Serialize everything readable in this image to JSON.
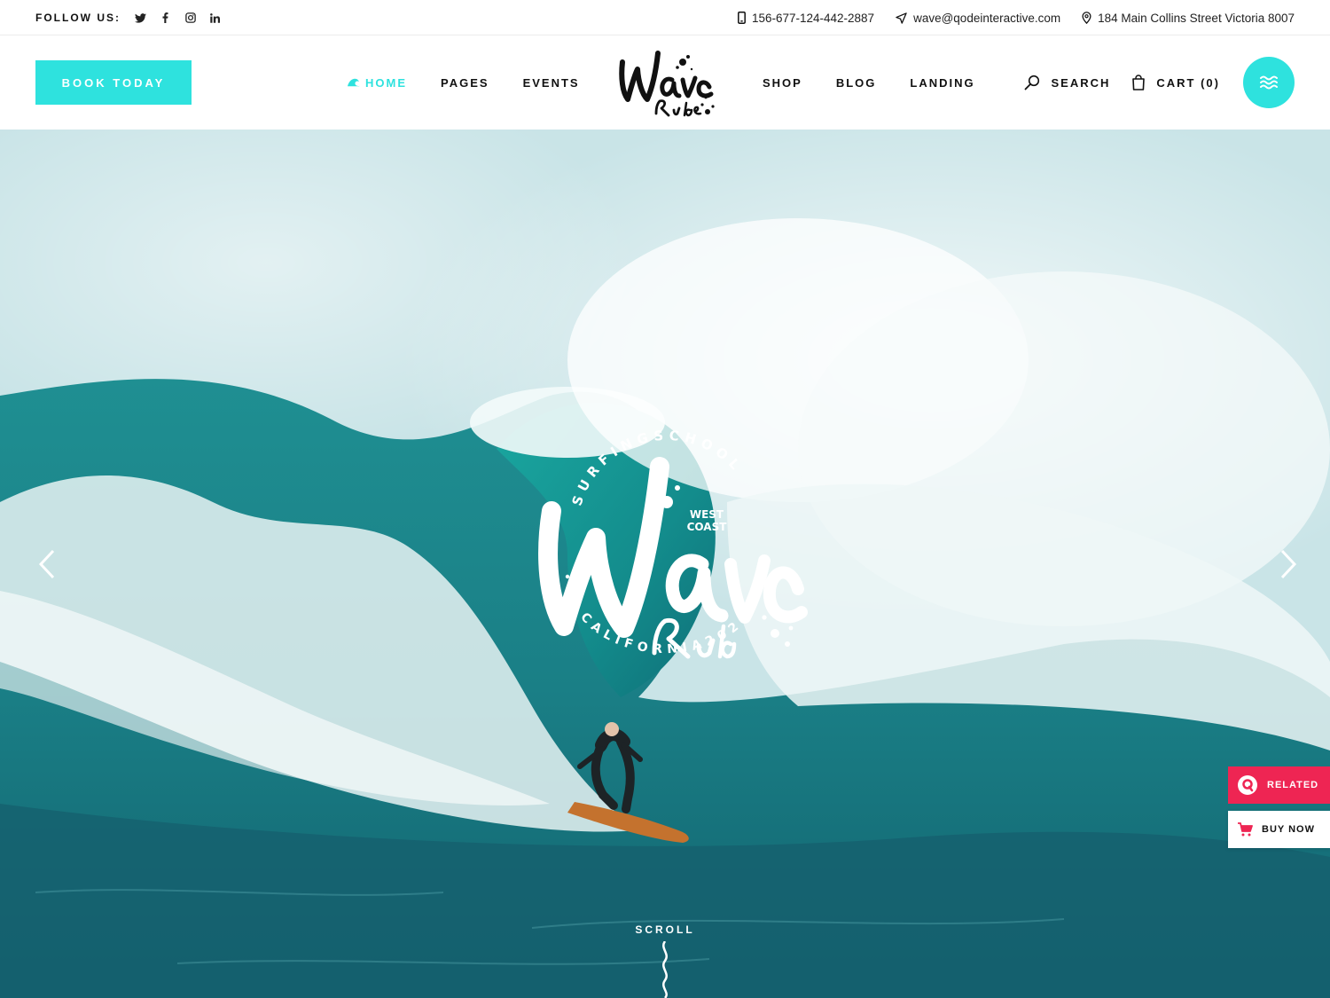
{
  "topbar": {
    "follow_label": "FOLLOW US:",
    "socials": [
      "twitter-icon",
      "facebook-icon",
      "instagram-icon",
      "linkedin-icon"
    ],
    "phone": "156-677-124-442-2887",
    "email": "wave@qodeinteractive.com",
    "address": "184 Main Collins Street Victoria 8007"
  },
  "header": {
    "book_label": "BOOK TODAY",
    "nav_left": [
      "HOME",
      "PAGES",
      "EVENTS"
    ],
    "nav_right": [
      "SHOP",
      "BLOG",
      "LANDING"
    ],
    "search_label": "SEARCH",
    "cart_label": "CART (0)"
  },
  "hero": {
    "badge_top": "SURFINGSCHOOL",
    "badge_mid": "WEST",
    "badge_mid2": "COAST",
    "badge_bottom": "CALIFORNIA2020",
    "scroll_label": "SCROLL"
  },
  "side": {
    "related_label": "RELATED",
    "buy_label": "BUY NOW"
  },
  "colors": {
    "accent": "#2ee2de",
    "related": "#ee2553"
  }
}
